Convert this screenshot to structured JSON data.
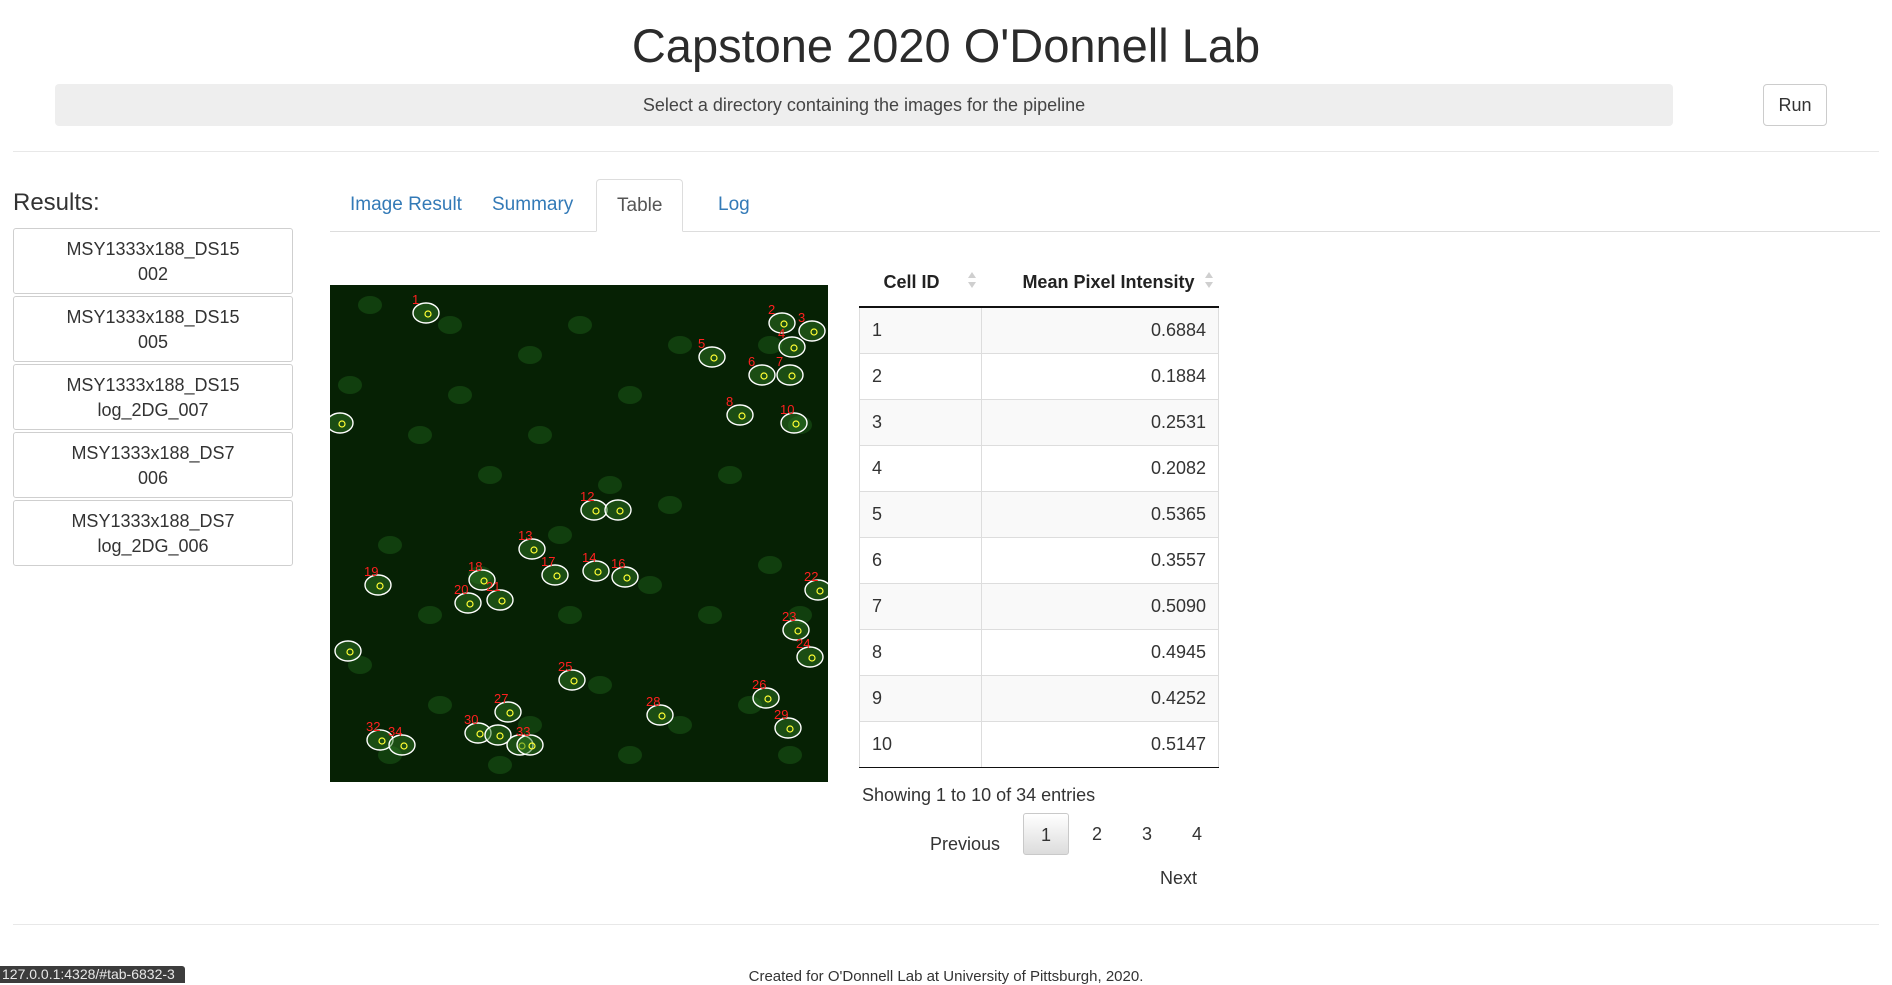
{
  "app": {
    "title": "Capstone 2020 O'Donnell Lab"
  },
  "toolbar": {
    "directory_prompt": "Select a directory containing the images for the pipeline",
    "run_label": "Run"
  },
  "results": {
    "heading": "Results:",
    "items": [
      {
        "line1": "MSY1333x188_DS15",
        "line2": "002"
      },
      {
        "line1": "MSY1333x188_DS15",
        "line2": "005"
      },
      {
        "line1": "MSY1333x188_DS15",
        "line2": "log_2DG_007"
      },
      {
        "line1": "MSY1333x188_DS7",
        "line2": "006"
      },
      {
        "line1": "MSY1333x188_DS7",
        "line2": "log_2DG_006"
      }
    ]
  },
  "tabs": [
    {
      "label": "Image Result",
      "active": false
    },
    {
      "label": "Summary",
      "active": false
    },
    {
      "label": "Table",
      "active": true
    },
    {
      "label": "Log",
      "active": false
    }
  ],
  "image": {
    "background_color": "#062104",
    "cell_label_color": "#ff2020",
    "outline_color": "#ffffff",
    "marker_color": "#ffff33",
    "cell_labels": [
      "1",
      "2",
      "3",
      "4",
      "5",
      "6",
      "7",
      "8",
      "10",
      "12",
      "13",
      "14",
      "16",
      "17",
      "18",
      "19",
      "20",
      "21",
      "22",
      "23",
      "24",
      "25",
      "26",
      "27",
      "28",
      "29",
      "30",
      "32",
      "33",
      "34"
    ]
  },
  "table": {
    "columns": [
      "Cell ID",
      "Mean Pixel Intensity"
    ],
    "rows": [
      {
        "id": "1",
        "value": "0.6884"
      },
      {
        "id": "2",
        "value": "0.1884"
      },
      {
        "id": "3",
        "value": "0.2531"
      },
      {
        "id": "4",
        "value": "0.2082"
      },
      {
        "id": "5",
        "value": "0.5365"
      },
      {
        "id": "6",
        "value": "0.3557"
      },
      {
        "id": "7",
        "value": "0.5090"
      },
      {
        "id": "8",
        "value": "0.4945"
      },
      {
        "id": "9",
        "value": "0.4252"
      },
      {
        "id": "10",
        "value": "0.5147"
      }
    ],
    "info": "Showing 1 to 10 of 34 entries"
  },
  "pagination": {
    "previous": "Previous",
    "pages": [
      "1",
      "2",
      "3",
      "4"
    ],
    "current": "1",
    "next": "Next"
  },
  "footer": {
    "text": "Created for O'Donnell Lab at University of Pittsburgh, 2020."
  },
  "status_bar": {
    "url": "127.0.0.1:4328/#tab-6832-3"
  }
}
